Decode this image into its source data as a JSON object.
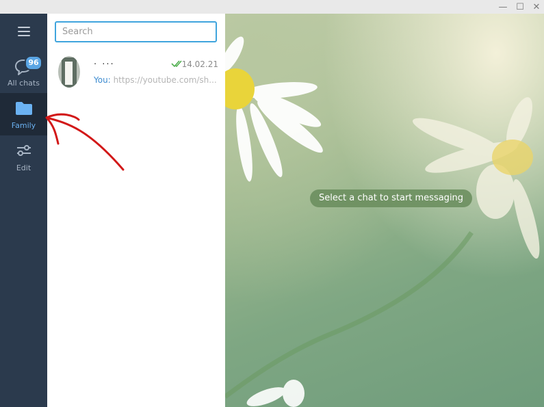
{
  "window": {
    "controls": {
      "minimize": "—",
      "maximize": "☐",
      "close": "✕"
    }
  },
  "sidebar": {
    "menu_icon": "hamburger-icon",
    "folders": [
      {
        "label": "All chats",
        "icon": "chat-bubble-icon",
        "badge": "96"
      },
      {
        "label": "Family",
        "icon": "folder-icon",
        "active": true
      },
      {
        "label": "Edit",
        "icon": "sliders-icon"
      }
    ]
  },
  "chatlist": {
    "search": {
      "value": "",
      "placeholder": "Search"
    },
    "chats": [
      {
        "name": ". ...",
        "time": "14.02.21",
        "status_icon": "double-check-icon",
        "preview_sender": "You:",
        "preview_text": "https://youtube.com/sh..."
      }
    ]
  },
  "main": {
    "empty_hint": "Select a chat to start messaging"
  },
  "colors": {
    "sidebar_bg": "#2b3a4d",
    "active_folder": "#6bb2f2",
    "accent": "#3fa4dd",
    "read_check": "#4fae4e"
  }
}
